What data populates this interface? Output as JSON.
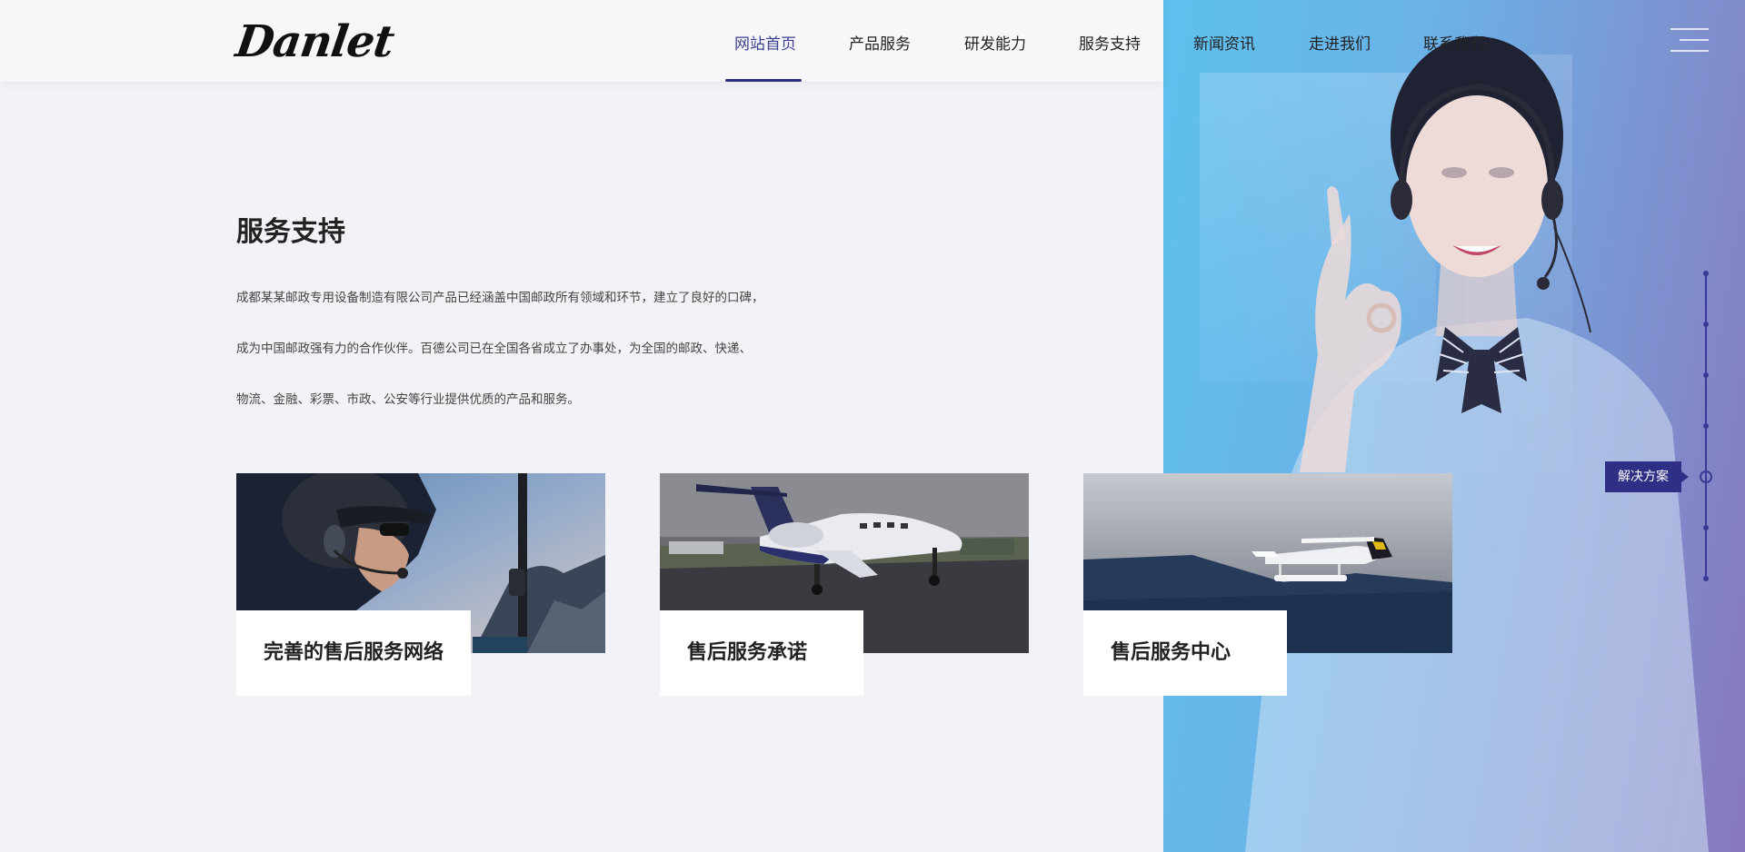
{
  "brand": {
    "logo_text": "Danlet"
  },
  "nav": {
    "items": [
      {
        "label": "网站首页",
        "active": true
      },
      {
        "label": "产品服务"
      },
      {
        "label": "研发能力"
      },
      {
        "label": "服务支持"
      },
      {
        "label": "新闻资讯"
      },
      {
        "label": "走进我们"
      },
      {
        "label": "联系我们"
      }
    ]
  },
  "section": {
    "title": "服务支持",
    "paragraph_lines": [
      " 成都某某邮政专用设备制造有限公司产品已经涵盖中国邮政所有领域和环节，建立了良好的口碑，",
      "成为中国邮政强有力的合作伙伴。百德公司已在全国各省成立了办事处，为全国的邮政、快递、",
      "物流、金融、彩票、市政、公安等行业提供优质的产品和服务。"
    ]
  },
  "cards": [
    {
      "label": "完善的售后服务网络",
      "image": "pilot-photo"
    },
    {
      "label": "售后服务承诺",
      "image": "private-jet-photo"
    },
    {
      "label": "售后服务中心",
      "image": "seaplane-photo"
    }
  ],
  "sidebar": {
    "solution_label": "解决方案"
  },
  "colors": {
    "accent": "#2f2f85",
    "hero_start": "#5ec0ee",
    "hero_end": "#8877bd"
  }
}
